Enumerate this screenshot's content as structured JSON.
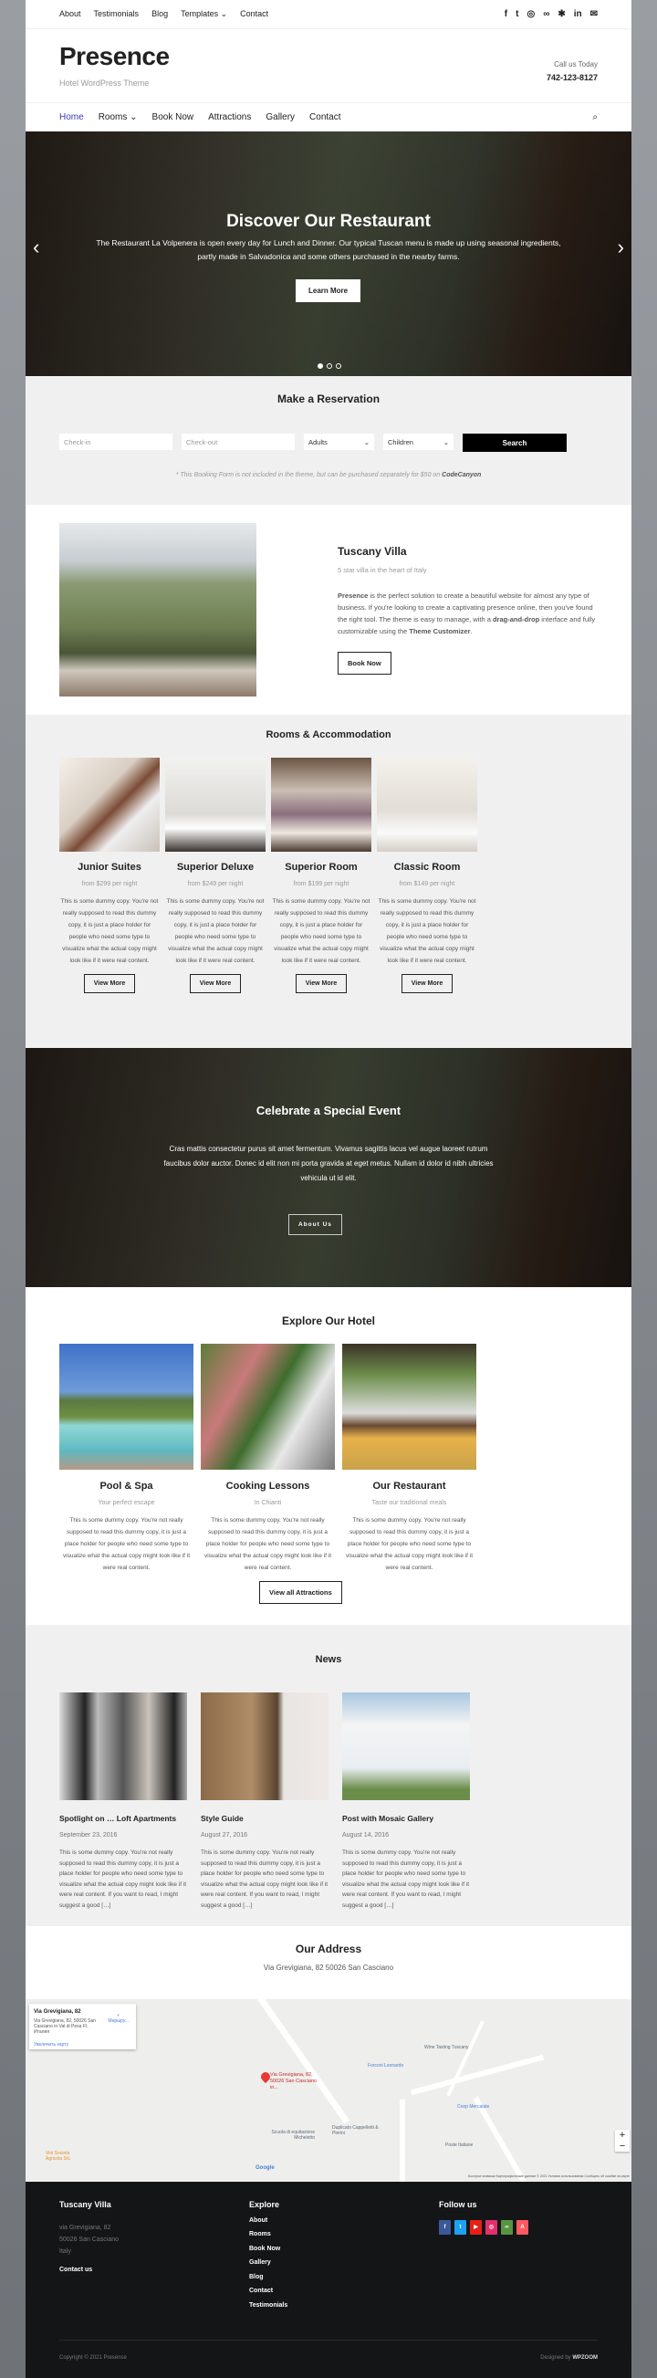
{
  "topbar": {
    "links": [
      "About",
      "Testimonials",
      "Blog",
      "Templates",
      "Contact"
    ],
    "social_icons": [
      "facebook-icon",
      "twitter-icon",
      "instagram-icon",
      "tripadvisor-icon",
      "yelp-icon",
      "linkedin-icon",
      "email-icon"
    ]
  },
  "header": {
    "title": "Presence",
    "tagline": "Hotel WordPress Theme",
    "call_label": "Call us Today",
    "phone": "742-123-8127"
  },
  "nav": {
    "items": [
      "Home",
      "Rooms",
      "Book Now",
      "Attractions",
      "Gallery",
      "Contact"
    ],
    "active": "Home",
    "accent": "#3b3bb3"
  },
  "hero": {
    "title": "Discover Our Restaurant",
    "text": "The Restaurant La Volpenera is open every day for Lunch and Dinner. Our typical Tuscan menu is made up using seasonal ingredients, partly made in Salvadonica and some others purchased in the nearby farms.",
    "button": "Learn More",
    "slides": 3,
    "current_slide": 1
  },
  "reservation": {
    "title": "Make a Reservation",
    "checkin_placeholder": "Check-in",
    "checkout_placeholder": "Check-out",
    "adults": "Adults",
    "children": "Children",
    "search": "Search",
    "note": "* This Booking Form is not included in the theme, but can be purchased separately for $50 on ",
    "note_link": "CodeCanyon"
  },
  "villa": {
    "title": "Tuscany Villa",
    "subtitle": "5 star villa in the heart of Italy",
    "brand": "Presence",
    "t1": " is the perfect solution to create a beautiful website for almost any type of business. If you're looking to create a captivating presence online, then you've found the right tool. The theme is easy to manage, with a ",
    "dnd": "drag-and-drop",
    "t2": " interface and fully customizable using the ",
    "customizer": "Theme Customizer",
    "t3": ".",
    "button": "Book Now"
  },
  "rooms": {
    "title": "Rooms & Accommodation",
    "items": [
      {
        "name": "Junior Suites",
        "price": "from $299 per night",
        "desc": "This is some dummy copy. You're not really supposed to read this dummy copy, it is just a place holder for people who need some type to visualize what the actual copy might look like if it were real content.",
        "button": "View More"
      },
      {
        "name": "Superior Deluxe",
        "price": "from $249 per night",
        "desc": "This is some dummy copy. You're not really supposed to read this dummy copy, it is just a place holder for people who need some type to visualize what the actual copy might look like if it were real content.",
        "button": "View More"
      },
      {
        "name": "Superior Room",
        "price": "from $199 per night",
        "desc": "This is some dummy copy. You're not really supposed to read this dummy copy, it is just a place holder for people who need some type to visualize what the actual copy might look like if it were real content.",
        "button": "View More"
      },
      {
        "name": "Classic Room",
        "price": "from $149 per night",
        "desc": "This is some dummy copy. You're not really supposed to read this dummy copy, it is just a place holder for people who need some type to visualize what the actual copy might look like if it were real content.",
        "button": "View More"
      }
    ]
  },
  "event": {
    "title": "Celebrate a Special Event",
    "text": "Cras mattis consectetur purus sit amet fermentum. Vivamus sagittis lacus vel augue laoreet rutrum faucibus dolor auctor. Donec id elit non mi porta gravida at eget metus. Nullam id dolor id nibh ultricies vehicula ut id elit.",
    "button": "About Us"
  },
  "explore": {
    "title": "Explore Our Hotel",
    "items": [
      {
        "name": "Pool & Spa",
        "sub": "Your perfect escape",
        "desc": "This is some dummy copy. You're not really supposed to read this dummy copy, it is just a place holder for people who need some type to visualize what the actual copy might look like if it were real content."
      },
      {
        "name": "Cooking Lessons",
        "sub": "In Chianti",
        "desc": "This is some dummy copy. You're not really supposed to read this dummy copy, it is just a place holder for people who need some type to visualize what the actual copy might look like if it were real content."
      },
      {
        "name": "Our Restaurant",
        "sub": "Taste our traditional meals",
        "desc": "This is some dummy copy. You're not really supposed to read this dummy copy, it is just a place holder for people who need some type to visualize what the actual copy might look like if it were real content."
      }
    ],
    "button": "View all Attractions"
  },
  "news": {
    "title": "News",
    "items": [
      {
        "title": "Spotlight on … Loft Apartments",
        "date": "September 23, 2016",
        "excerpt": "This is some dummy copy. You're not really supposed to read this dummy copy, it is just a place holder for people who need some type to visualize what the actual copy might look like if it were real content. If you want to read, I might suggest a good […]"
      },
      {
        "title": "Style Guide",
        "date": "August 27, 2016",
        "excerpt": "This is some dummy copy. You're not really supposed to read this dummy copy, it is just a place holder for people who need some type to visualize what the actual copy might look like if it were real content. If you want to read, I might suggest a good […]"
      },
      {
        "title": "Post with Mosaic Gallery",
        "date": "August 14, 2016",
        "excerpt": "This is some dummy copy. You're not really supposed to read this dummy copy, it is just a place holder for people who need some type to visualize what the actual copy might look like if it were real content. If you want to read, I might suggest a good […]"
      }
    ]
  },
  "address": {
    "title": "Our Address",
    "text": "Via Grevigiana, 82 50026 San Casciano"
  },
  "map": {
    "card_title": "Via Grevigiana, 82",
    "card_addr": "Via Grevigiana, 82, 50026 San Casciano in Val di Pesa FI, Италия",
    "directions": "Маршру...",
    "enlarge": "Увеличить карту",
    "pin_label": "Via Grevigiana, 82, 50026 San Casciano in...",
    "pois": [
      "Wine Tasting Tuscany",
      "Forconi Leonardo",
      "Coop Mercatale",
      "Scuola di equitazione Micheletto",
      "Duplicato Cappelletti & Pierini",
      "Poste Italiane",
      "Vini Societa Agricola SrL"
    ],
    "google": "Google",
    "attribution": "Быстрые клавиши   Картографические данные © 2021   Условия использования   Сообщить об ошибке на карте"
  },
  "footer": {
    "col1_title": "Tuscany Villa",
    "addr": [
      "via Grevigiana, 82",
      "50026 San Casciano",
      "Italy"
    ],
    "contact": "Contact us",
    "col2_title": "Explore",
    "links": [
      "About",
      "Rooms",
      "Book Now",
      "Gallery",
      "Blog",
      "Contact",
      "Testimonials"
    ],
    "col3_title": "Follow us",
    "social": [
      {
        "icon": "facebook-icon",
        "color": "#3b5998",
        "g": "f"
      },
      {
        "icon": "twitter-icon",
        "color": "#1da1f2",
        "g": "t"
      },
      {
        "icon": "youtube-icon",
        "color": "#e62117",
        "g": "▶"
      },
      {
        "icon": "instagram-icon",
        "color": "#e1306c",
        "g": "◎"
      },
      {
        "icon": "tripadvisor-icon",
        "color": "#589442",
        "g": "∞"
      },
      {
        "icon": "airbnb-icon",
        "color": "#ff5a5f",
        "g": "A"
      }
    ],
    "copyright": "Copyright © 2021 Presence",
    "designed": "Designed by ",
    "designer": "WPZOOM"
  }
}
